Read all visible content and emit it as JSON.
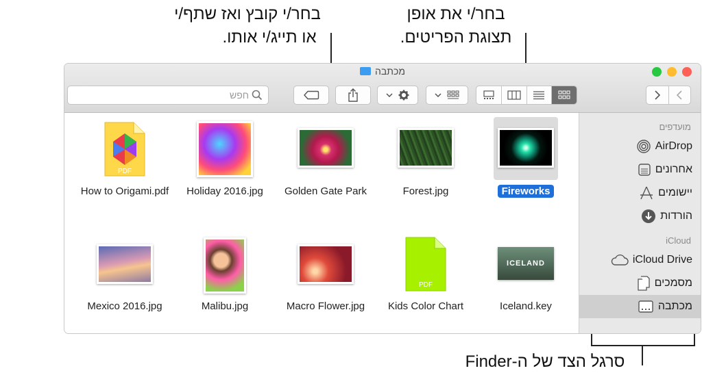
{
  "callouts": {
    "file_share_line1": "בחר/י קובץ ואז שתף/י",
    "file_share_line2": "או תייג/י אותו.",
    "view_line1": "בחר/י את אופן",
    "view_line2": "תצוגת הפריטים.",
    "sidebar": "סרגל הצד של ה-Finder"
  },
  "window": {
    "title": "מכתבה"
  },
  "toolbar": {
    "search_placeholder": "חפש"
  },
  "sidebar": {
    "favorites_header": "מועדפים",
    "favorites": [
      "AirDrop",
      "אחרונים",
      "יישומים",
      "הורדות"
    ],
    "icloud_header": "iCloud",
    "icloud": [
      "iCloud Drive",
      "מסמכים",
      "מכתבה"
    ]
  },
  "files": {
    "row1": [
      "How to Origami.pdf",
      "Holiday 2016.jpg",
      "Golden Gate Park",
      "Forest.jpg",
      "Fireworks"
    ],
    "row2": [
      "Mexico 2016.jpg",
      "Malibu.jpg",
      "Macro Flower.jpg",
      "Kids Color Chart",
      "Iceland.key"
    ]
  },
  "badges": {
    "pdf": "PDF",
    "iceland": "ICELAND"
  },
  "colors": {
    "selection": "#1e6fd9",
    "close": "#fe5f57",
    "minimize": "#febc2e",
    "zoom": "#28c840"
  }
}
